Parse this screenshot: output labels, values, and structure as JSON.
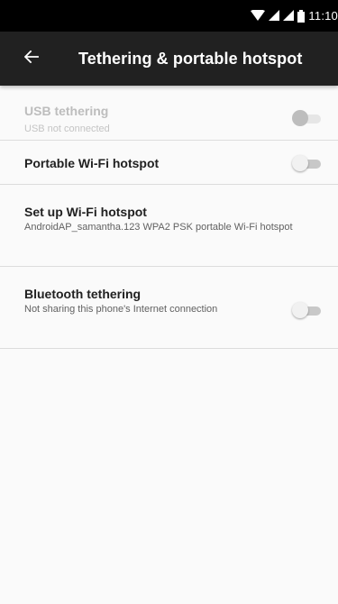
{
  "status_bar": {
    "time": "11:10",
    "icons": [
      "wifi-icon",
      "signal-icon",
      "signal-icon",
      "battery-icon"
    ]
  },
  "app_bar": {
    "back_icon": "arrow-back-icon",
    "title": "Tethering & portable hotspot"
  },
  "preferences": [
    {
      "title": "USB tethering",
      "summary": "USB not connected",
      "enabled": false,
      "switch_on": false
    },
    {
      "title": "Portable Wi-Fi hotspot",
      "summary": "",
      "enabled": true,
      "switch_on": false
    },
    {
      "title": "Set up Wi-Fi hotspot",
      "summary": "AndroidAP_samantha.123 WPA2 PSK portable Wi-Fi hotspot",
      "enabled": true
    },
    {
      "title": "Bluetooth tethering",
      "summary": "Not sharing this phone's Internet connection",
      "enabled": true,
      "switch_on": false
    }
  ],
  "colors": {
    "status_bar": "#000000",
    "app_bar": "#212121",
    "background": "#fafafa",
    "divider": "#dcdcdc"
  }
}
